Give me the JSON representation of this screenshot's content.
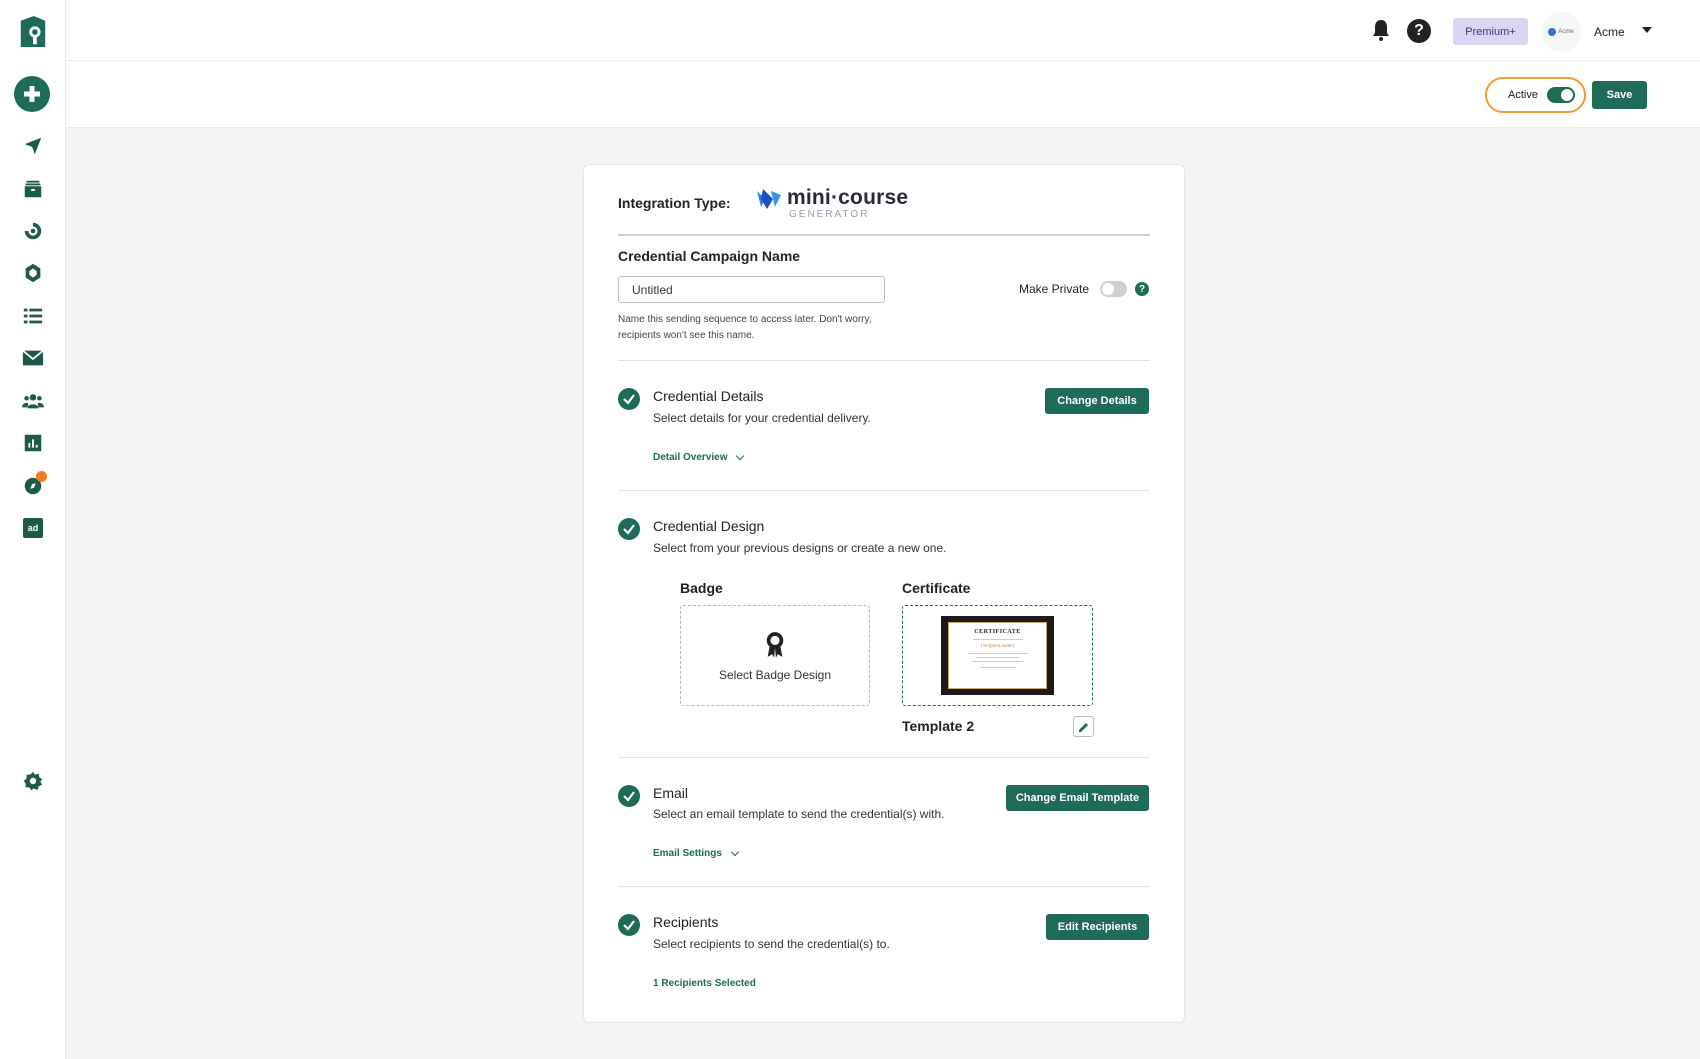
{
  "sidebar": {
    "icons": [
      "app-logo-icon",
      "create-plus-icon",
      "send-icon",
      "archive-icon",
      "integration-icon",
      "badge-icon",
      "list-icon",
      "mail-icon",
      "users-icon",
      "analytics-icon",
      "compass-icon",
      "ad-icon",
      "settings-icon"
    ],
    "ad_label": "ad"
  },
  "header": {
    "help_symbol": "?",
    "plan_label": "Premium+",
    "account_logo_text": "Acme",
    "account_name": "Acme"
  },
  "subbar": {
    "active_label": "Active",
    "active_on": true,
    "save_label": "Save"
  },
  "card": {
    "integration_label": "Integration Type:",
    "integration_logo_title": "mini·course",
    "integration_logo_sub": "GENERATOR",
    "campaign_name_label": "Credential Campaign Name",
    "campaign_name_value": "Untitled",
    "campaign_name_helper": "Name this sending sequence to access later. Don't worry, recipients won't see this name.",
    "make_private_label": "Make Private",
    "make_private_on": false,
    "help_symbol": "?",
    "sections": {
      "details": {
        "title": "Credential Details",
        "desc": "Select details for your credential delivery.",
        "button": "Change Details",
        "link": "Detail Overview"
      },
      "design": {
        "title": "Credential Design",
        "desc": "Select from your previous designs or create a new one.",
        "badge_title": "Badge",
        "badge_placeholder": "Select Badge Design",
        "certificate_title": "Certificate",
        "certificate_thumb_heading": "CERTIFICATE",
        "certificate_thumb_name": "{recipient.name}",
        "template_name": "Template 2"
      },
      "email": {
        "title": "Email",
        "desc": "Select an email template to send the credential(s) with.",
        "button": "Change Email Template",
        "link": "Email Settings"
      },
      "recipients": {
        "title": "Recipients",
        "desc": "Select recipients to send the credential(s) to.",
        "button": "Edit Recipients",
        "link": "1 Recipients Selected"
      }
    }
  },
  "colors": {
    "brand_green": "#1e6b57",
    "active_outline": "#f29b2f",
    "premium_bg": "#d9d6f5",
    "notification_dot": "#f07b20"
  }
}
